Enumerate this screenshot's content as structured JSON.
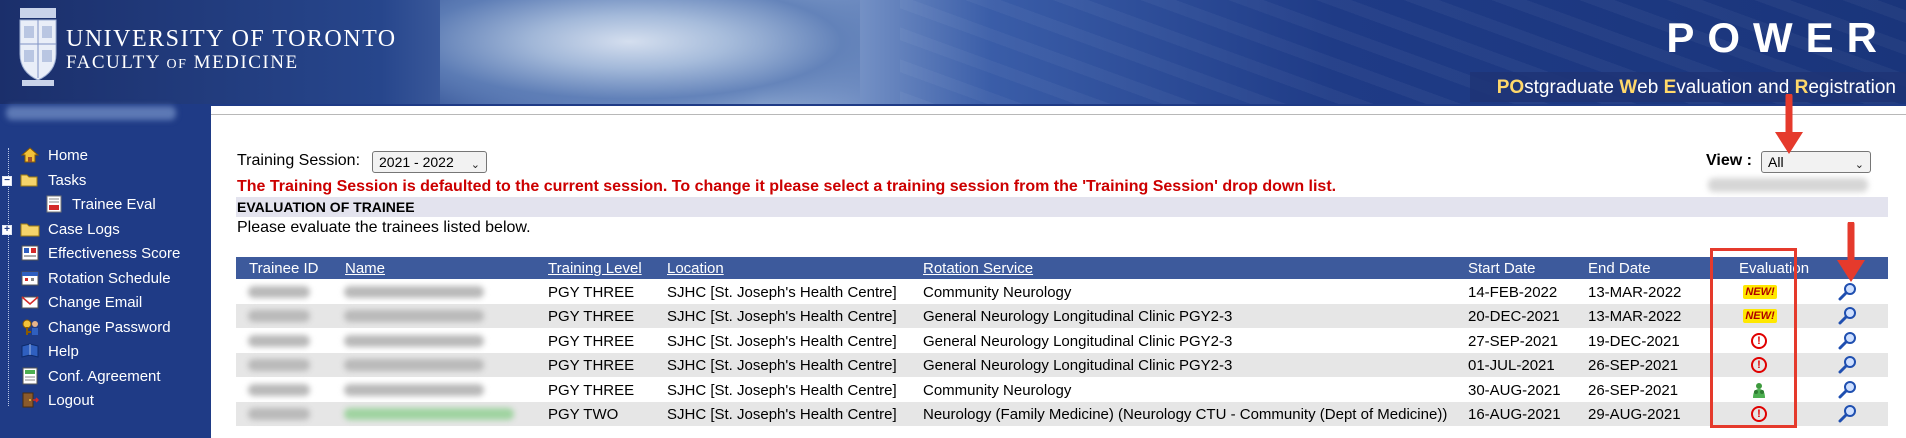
{
  "header": {
    "university": "UNIVERSITY OF TORONTO",
    "faculty_prefix": "FACULTY",
    "faculty_of": "OF",
    "faculty_suffix": "MEDICINE",
    "app_name": "POWER",
    "app_subtitle_parts": [
      {
        "t": "PO",
        "b": true
      },
      {
        "t": "stgraduate ",
        "b": false
      },
      {
        "t": "W",
        "b": true
      },
      {
        "t": "eb ",
        "b": false
      },
      {
        "t": "E",
        "b": true
      },
      {
        "t": "valuation and ",
        "b": false
      },
      {
        "t": "R",
        "b": true
      },
      {
        "t": "egistration",
        "b": false
      }
    ]
  },
  "sidebar": {
    "items": [
      {
        "label": "Home",
        "icon": "house-icon"
      },
      {
        "label": "Tasks",
        "icon": "folder-open-icon"
      },
      {
        "label": "Trainee Eval",
        "icon": "evaluation-form-icon"
      },
      {
        "label": "Case Logs",
        "icon": "folder-icon"
      },
      {
        "label": "Effectiveness Score",
        "icon": "score-card-icon"
      },
      {
        "label": "Rotation Schedule",
        "icon": "schedule-icon"
      },
      {
        "label": "Change Email",
        "icon": "email-icon"
      },
      {
        "label": "Change Password",
        "icon": "key-person-icon"
      },
      {
        "label": "Help",
        "icon": "book-icon"
      },
      {
        "label": "Conf. Agreement",
        "icon": "document-icon"
      },
      {
        "label": "Logout",
        "icon": "logout-icon"
      }
    ]
  },
  "filters": {
    "training_session_label": "Training Session:",
    "training_session_value": "2021 - 2022",
    "view_label": "View :",
    "view_value": "All"
  },
  "warning": "The Training Session is defaulted to the current session. To change it please select a training session from the 'Training Session' drop down list.",
  "section": {
    "title": "EVALUATION OF TRAINEE",
    "description": "Please evaluate the trainees listed below."
  },
  "table": {
    "columns": [
      "Trainee ID",
      "Name",
      "Training Level",
      "Location",
      "Rotation Service",
      "Start Date",
      "End Date",
      "Evaluation"
    ],
    "rows": [
      {
        "level": "PGY THREE",
        "location": "SJHC [St. Joseph's Health Centre]",
        "service": "Community Neurology",
        "start": "14-FEB-2022",
        "end": "13-MAR-2022",
        "evaluation": "new",
        "badge": "NEW!"
      },
      {
        "level": "PGY THREE",
        "location": "SJHC [St. Joseph's Health Centre]",
        "service": "General Neurology Longitudinal Clinic PGY2-3",
        "start": "20-DEC-2021",
        "end": "13-MAR-2022",
        "evaluation": "new",
        "badge": "NEW!"
      },
      {
        "level": "PGY THREE",
        "location": "SJHC [St. Joseph's Health Centre]",
        "service": "General Neurology Longitudinal Clinic PGY2-3",
        "start": "27-SEP-2021",
        "end": "19-DEC-2021",
        "evaluation": "overdue",
        "badge": "!"
      },
      {
        "level": "PGY THREE",
        "location": "SJHC [St. Joseph's Health Centre]",
        "service": "General Neurology Longitudinal Clinic PGY2-3",
        "start": "01-JUL-2021",
        "end": "26-SEP-2021",
        "evaluation": "overdue",
        "badge": "!"
      },
      {
        "level": "PGY THREE",
        "location": "SJHC [St. Joseph's Health Centre]",
        "service": "Community Neurology",
        "start": "30-AUG-2021",
        "end": "26-SEP-2021",
        "evaluation": "completed",
        "badge": ""
      },
      {
        "level": "PGY TWO",
        "location": "SJHC [St. Joseph's Health Centre]",
        "service": "Neurology (Family Medicine) (Neurology CTU - Community (Dept of Medicine))",
        "start": "16-AUG-2021",
        "end": "29-AUG-2021",
        "evaluation": "overdue",
        "badge": "!"
      }
    ]
  },
  "colors": {
    "nav_blue": "#1f3b86",
    "table_header": "#3d5a9c",
    "warning_red": "#cc0000",
    "annotation_red": "#e53a2c"
  }
}
